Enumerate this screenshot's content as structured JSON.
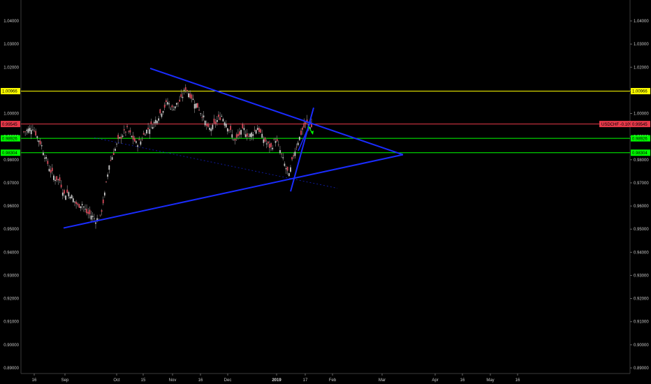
{
  "chart_data": {
    "type": "candlestick",
    "symbol_label": "USDCHF -0.10%",
    "y_ticks": [
      "1.04000",
      "1.03000",
      "1.02000",
      "1.01000",
      "1.00000",
      "0.99000",
      "0.98000",
      "0.97000",
      "0.96000",
      "0.95000",
      "0.94000",
      "0.93000",
      "0.92000",
      "0.91000",
      "0.90000",
      "0.89000"
    ],
    "ylim": [
      0.887,
      1.049
    ],
    "x_ticks": [
      {
        "label": "16",
        "bold": false
      },
      {
        "label": "Sep",
        "bold": false
      },
      {
        "label": "Oct",
        "bold": false
      },
      {
        "label": "15",
        "bold": false
      },
      {
        "label": "Nov",
        "bold": false
      },
      {
        "label": "16",
        "bold": false
      },
      {
        "label": "Dec",
        "bold": false
      },
      {
        "label": "2019",
        "bold": true
      },
      {
        "label": "17",
        "bold": false
      },
      {
        "label": "Feb",
        "bold": false
      },
      {
        "label": "Mar",
        "bold": false
      },
      {
        "label": "Apr",
        "bold": false
      },
      {
        "label": "16",
        "bold": false
      },
      {
        "label": "May",
        "bold": false
      },
      {
        "label": "16",
        "bold": false
      }
    ],
    "levels": [
      {
        "value": 1.00966,
        "label": "1.00966",
        "color": "#ffff00",
        "tag_text": "#000000"
      },
      {
        "value": 0.99545,
        "label": "0.99545",
        "color": "#e8394a",
        "tag_text": "#ffffff"
      },
      {
        "value": 0.98926,
        "label": "0.98926",
        "color": "#00ff00",
        "tag_text": "#000000"
      },
      {
        "value": 0.98304,
        "label": "0.98304",
        "color": "#00ff00",
        "tag_text": "#000000"
      }
    ],
    "price_path": [
      0.992,
      0.993,
      0.994,
      0.99,
      0.986,
      0.98,
      0.975,
      0.972,
      0.971,
      0.965,
      0.966,
      0.963,
      0.96,
      0.961,
      0.957,
      0.956,
      0.954,
      0.955,
      0.965,
      0.978,
      0.983,
      0.988,
      0.991,
      0.993,
      0.99,
      0.987,
      0.988,
      0.992,
      0.994,
      0.996,
      0.999,
      1.002,
      1.005,
      1.002,
      1.004,
      1.006,
      1.011,
      1.008,
      1.005,
      1.002,
      0.998,
      0.993,
      0.994,
      0.997,
      0.999,
      0.996,
      0.992,
      0.988,
      0.991,
      0.993,
      0.99,
      0.992,
      0.994,
      0.99,
      0.987,
      0.985,
      0.989,
      0.984,
      0.978,
      0.973,
      0.982,
      0.988,
      0.993,
      0.996,
      0.994
    ]
  }
}
